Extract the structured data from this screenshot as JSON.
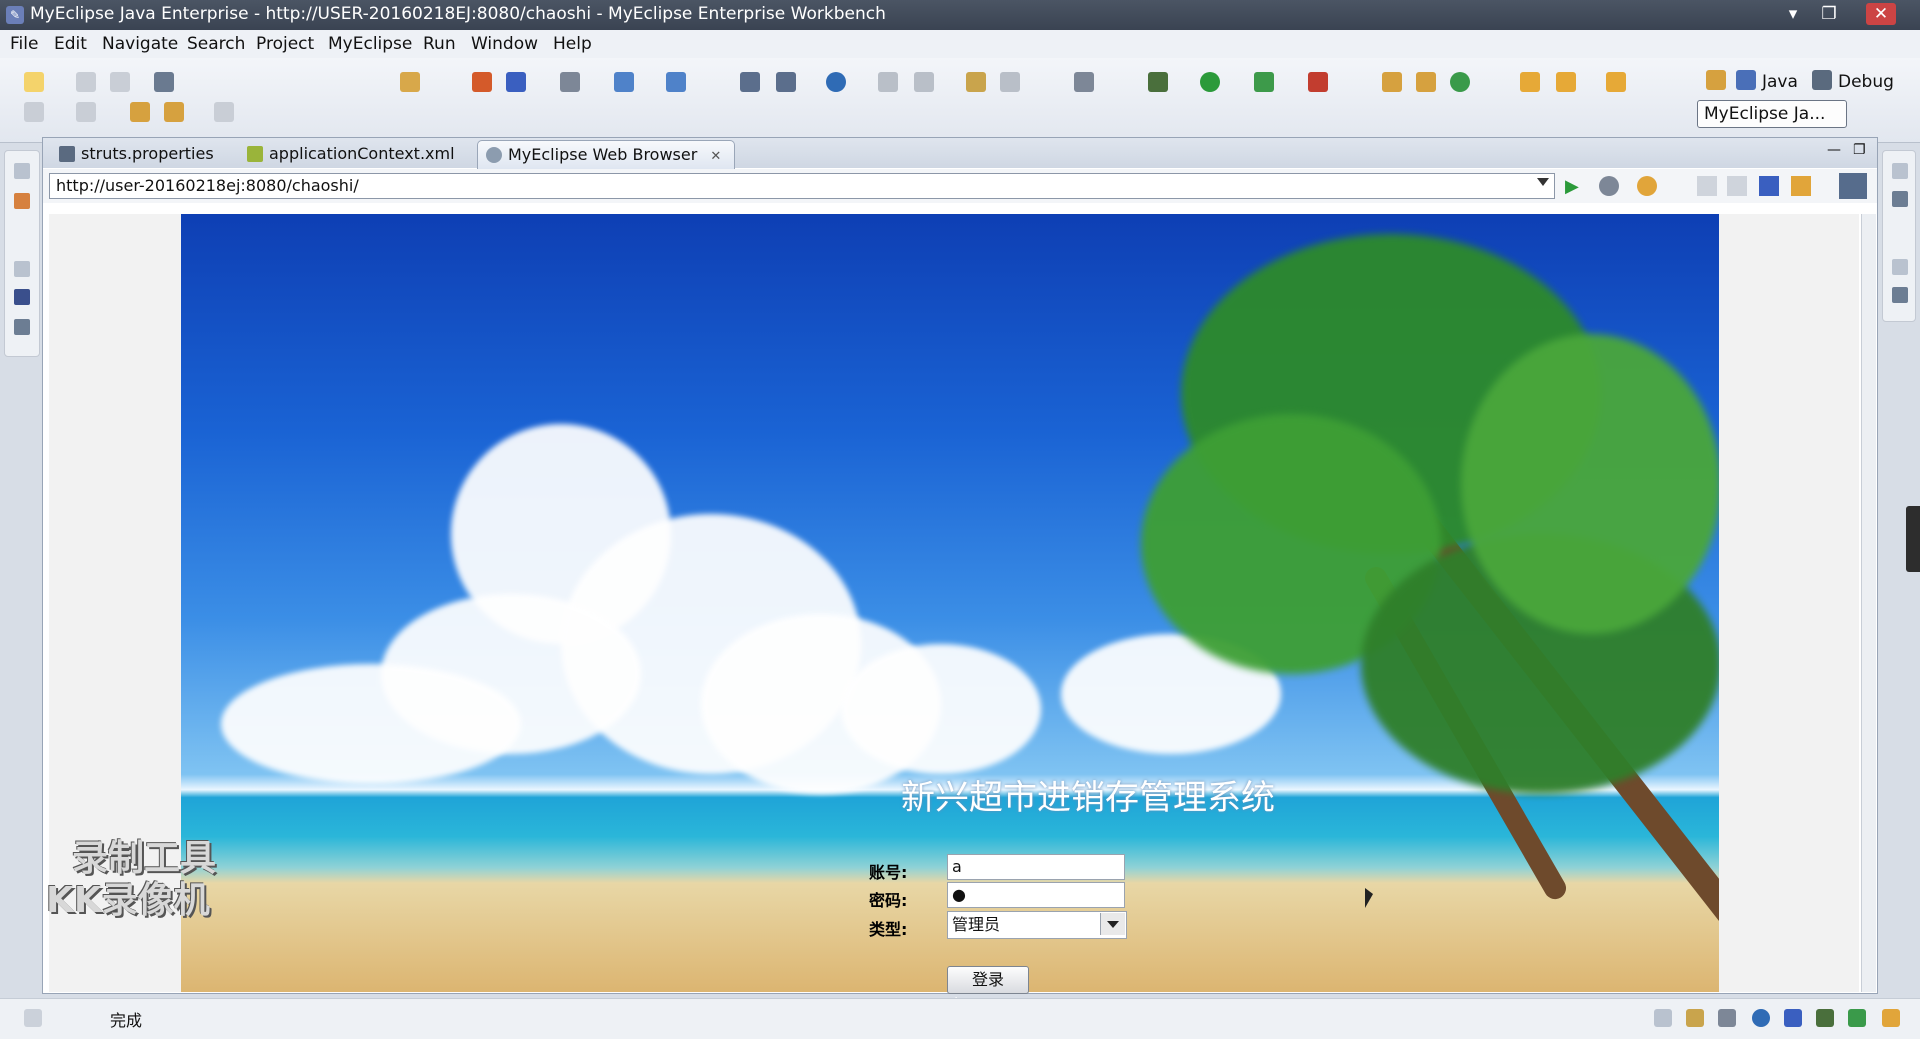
{
  "window": {
    "title": "MyEclipse Java Enterprise - http://USER-20160218EJ:8080/chaoshi - MyEclipse Enterprise Workbench"
  },
  "menu": [
    "File",
    "Edit",
    "Navigate",
    "Search",
    "Project",
    "MyEclipse",
    "Run",
    "Window",
    "Help"
  ],
  "perspectives": {
    "java": "Java",
    "debug": "Debug",
    "active": "MyEclipse Ja..."
  },
  "tabs": [
    {
      "label": "struts.properties"
    },
    {
      "label": "applicationContext.xml"
    },
    {
      "label": "MyEclipse Web Browser"
    }
  ],
  "browser": {
    "url": "http://user-20160218ej:8080/chaoshi/"
  },
  "login": {
    "title": "新兴超市进销存管理系统",
    "account_label": "账号:",
    "account_value": "a",
    "password_label": "密码:",
    "password_value": "●",
    "type_label": "类型:",
    "type_value": "管理员",
    "submit_label": "登录"
  },
  "watermark": {
    "line1": "录制工具",
    "line2": "KK录像机"
  },
  "status": {
    "text": "完成"
  },
  "colors": {
    "titlebar": "#3a4352",
    "sky": "#1a63d4",
    "sand": "#dcb571"
  },
  "icons": [
    "window-app-icon",
    "minimize-icon",
    "restore-icon",
    "close-icon",
    "tab-properties-icon",
    "tab-xml-icon",
    "tab-browser-icon",
    "tab-close-icon",
    "go-icon",
    "stop-icon",
    "refresh-icon",
    "back-icon",
    "forward-icon"
  ]
}
